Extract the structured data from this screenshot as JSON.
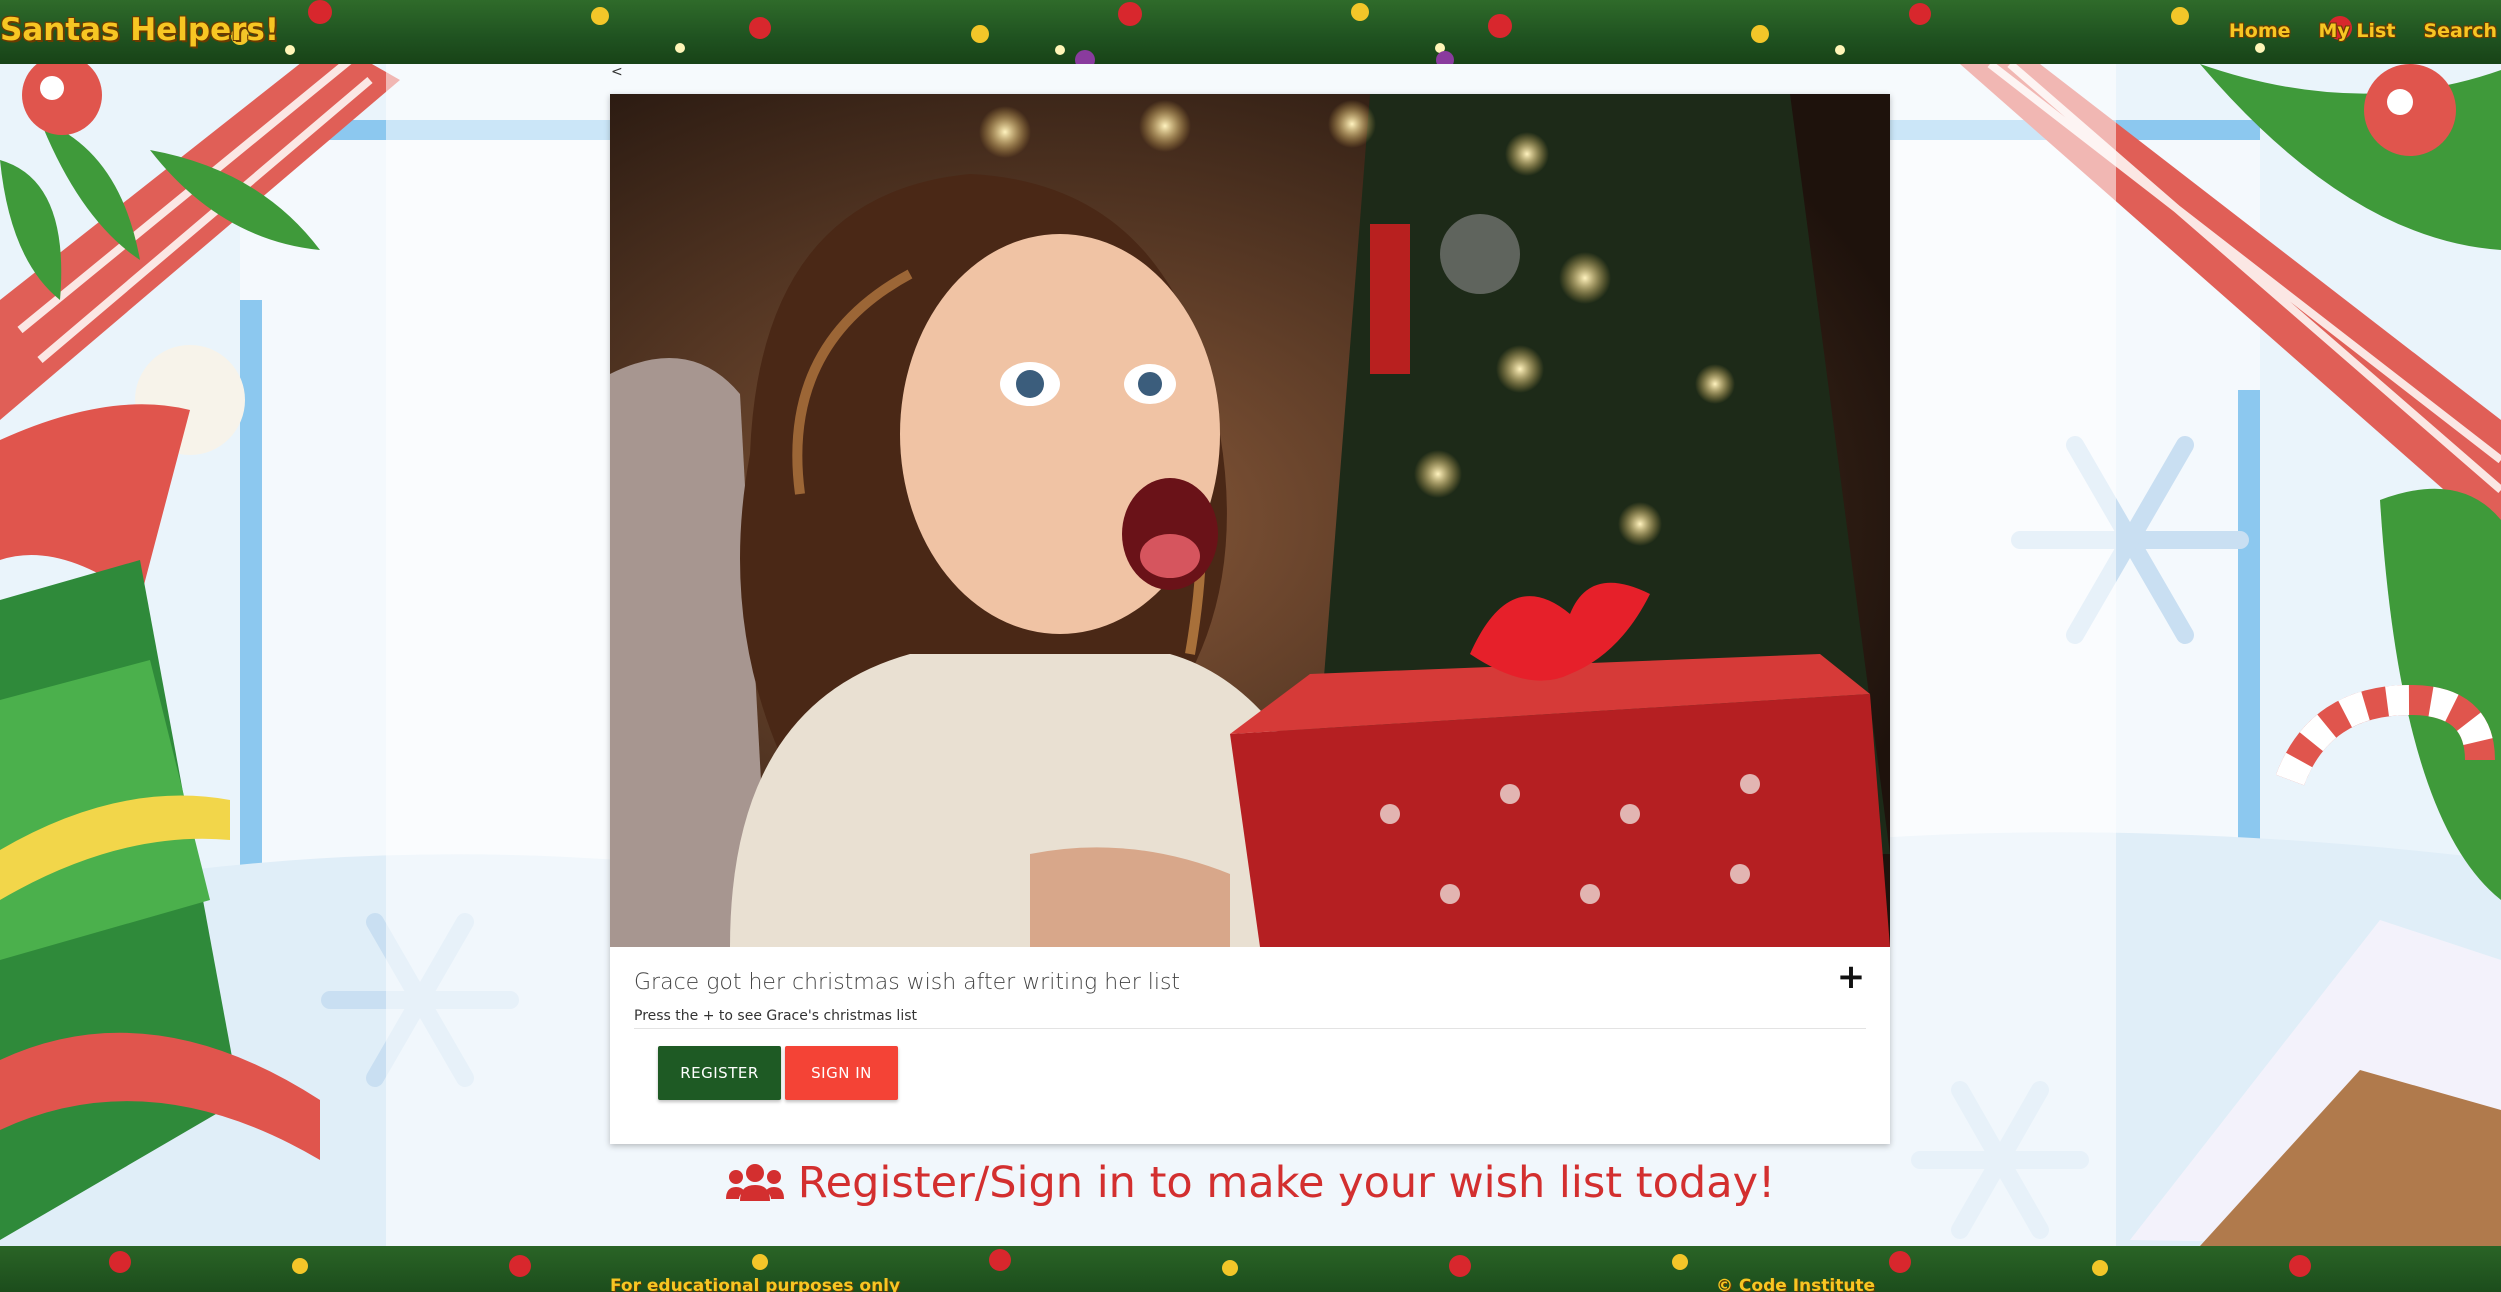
{
  "header": {
    "brand": "Santas Helpers!",
    "nav": [
      {
        "label": "Home"
      },
      {
        "label": "My List"
      },
      {
        "label": "Search"
      }
    ]
  },
  "back_link": "<",
  "card": {
    "image_icon": "girl-with-gift-photo",
    "title": "Grace got her christmas wish after writing her list",
    "expand_label": "+",
    "hint": "Press the + to see Grace's christmas list",
    "register_label": "REGISTER",
    "signin_label": "SIGN IN"
  },
  "cta": {
    "icon": "users-icon",
    "text": "Register/Sign in to make your wish list today!"
  },
  "footer": {
    "left_text": "For educational purposes only",
    "right_text": "© Code Institute"
  },
  "colors": {
    "brand_gold": "#f7c623",
    "register_green": "#1e5a24",
    "signin_red": "#f44336",
    "cta_red": "#d32f2f",
    "garland_green": "#1f5220"
  }
}
